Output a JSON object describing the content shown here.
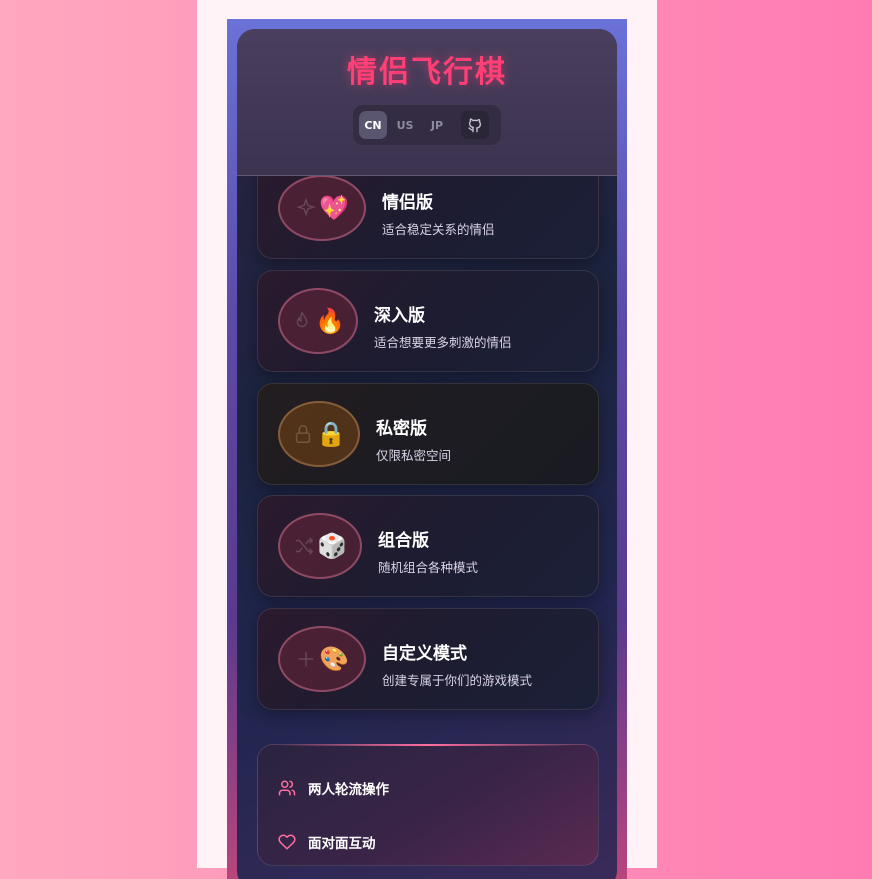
{
  "app": {
    "title": "情侣飞行棋"
  },
  "languages": [
    {
      "label": "CN",
      "active": true
    },
    {
      "label": "US",
      "active": false
    },
    {
      "label": "JP",
      "active": false
    }
  ],
  "modes": [
    {
      "name": "情侣版",
      "desc": "适合稳定关系的情侣",
      "emoji": "💖",
      "icon": "sparkles-icon"
    },
    {
      "name": "深入版",
      "desc": "适合想要更多刺激的情侣",
      "emoji": "🔥",
      "icon": "flame-icon"
    },
    {
      "name": "私密版",
      "desc": "仅限私密空间",
      "emoji": "🔒",
      "icon": "lock-icon",
      "locked": true
    },
    {
      "name": "组合版",
      "desc": "随机组合各种模式",
      "emoji": "🎲",
      "icon": "shuffle-icon"
    },
    {
      "name": "自定义模式",
      "desc": "创建专属于你们的游戏模式",
      "emoji": "🎨",
      "icon": "plus-icon"
    }
  ],
  "features": [
    {
      "label": "两人轮流操作",
      "icon": "users-icon"
    },
    {
      "label": "面对面互动",
      "icon": "heart-icon"
    }
  ],
  "colors": {
    "accent": "#ff3f76",
    "page_bg": "#ff8fb8"
  }
}
